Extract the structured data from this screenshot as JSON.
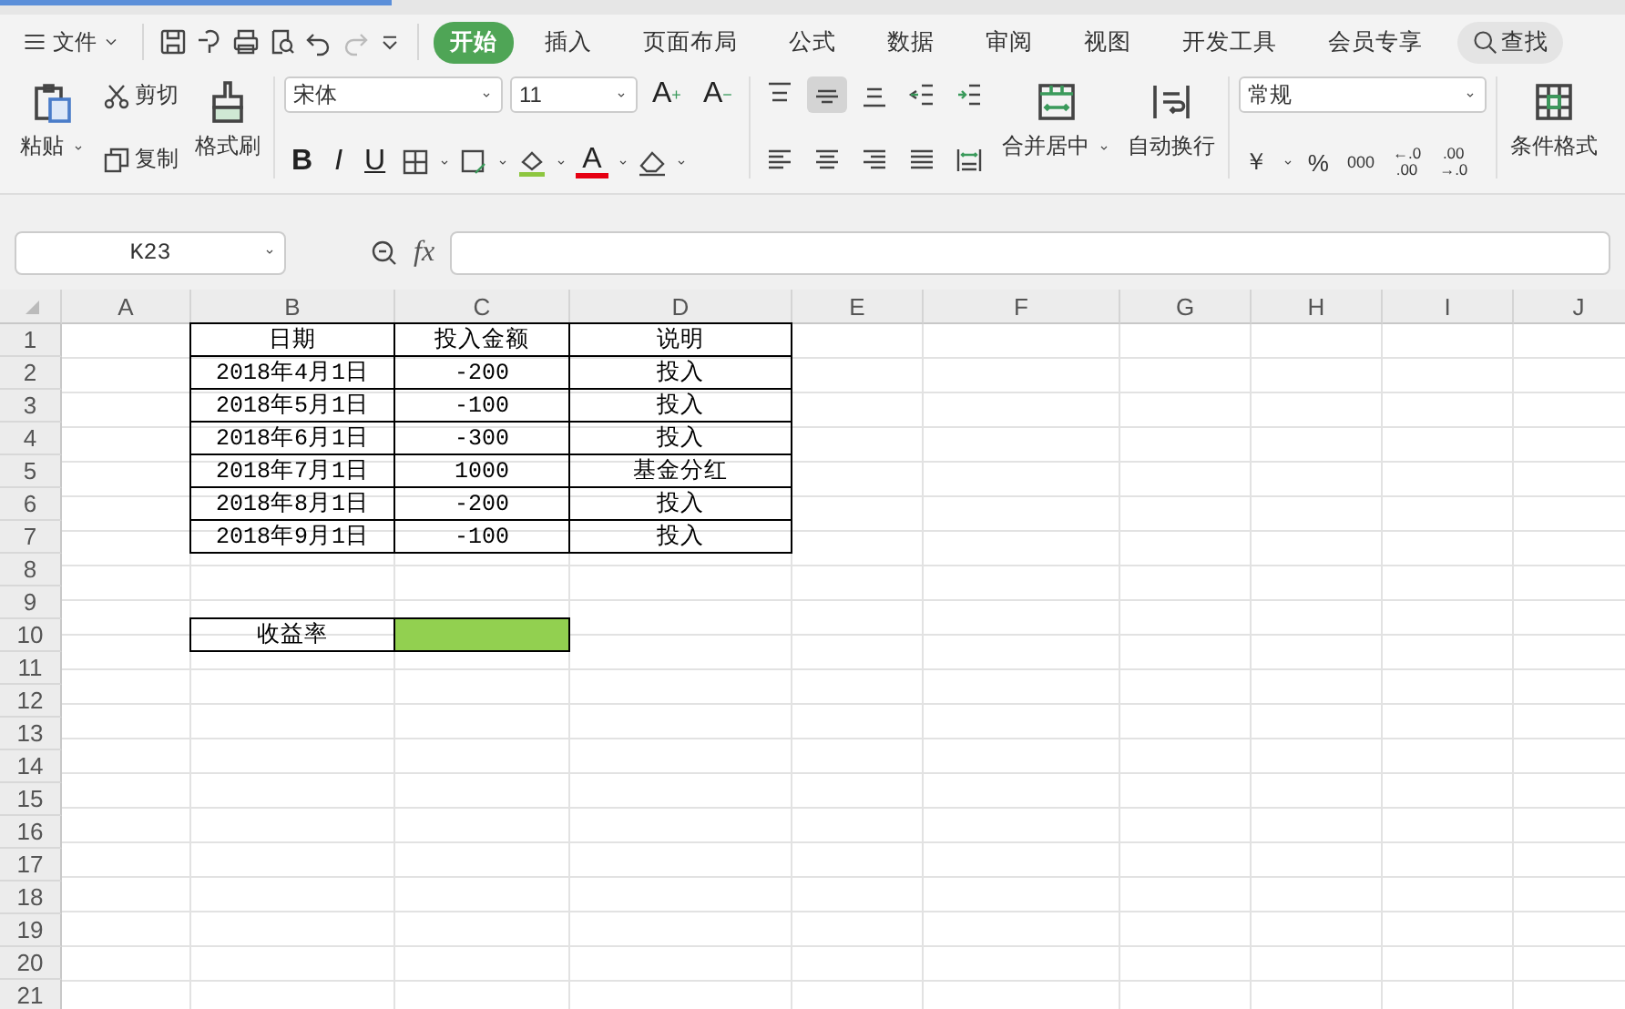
{
  "menu": {
    "file": "文件",
    "tabs": [
      {
        "label": "开始",
        "selected": true
      },
      {
        "label": "插入",
        "selected": false
      },
      {
        "label": "页面布局",
        "selected": false
      },
      {
        "label": "公式",
        "selected": false
      },
      {
        "label": "数据",
        "selected": false
      },
      {
        "label": "审阅",
        "selected": false
      },
      {
        "label": "视图",
        "selected": false
      },
      {
        "label": "开发工具",
        "selected": false
      },
      {
        "label": "会员专享",
        "selected": false
      }
    ],
    "search": "查找"
  },
  "ribbon": {
    "paste": "粘贴",
    "cut": "剪切",
    "copy": "复制",
    "format_painter": "格式刷",
    "font_name": "宋体",
    "font_size": "11",
    "size_buttons": [
      {
        "label": "A",
        "sign": "+"
      },
      {
        "label": "A",
        "sign": "−"
      }
    ],
    "style_buttons": [
      "B",
      "I",
      "U"
    ],
    "font_color": "A",
    "align_top": [
      {
        "kind": "top",
        "selected": false
      },
      {
        "kind": "middle",
        "selected": true
      },
      {
        "kind": "bottom",
        "selected": false
      },
      {
        "kind": "outdent",
        "selected": false
      },
      {
        "kind": "indent",
        "selected": false
      }
    ],
    "align_bottom": [
      {
        "kind": "left",
        "selected": false
      },
      {
        "kind": "center",
        "selected": false
      },
      {
        "kind": "right",
        "selected": false
      },
      {
        "kind": "justify",
        "selected": false
      },
      {
        "kind": "distribute",
        "selected": false
      }
    ],
    "merge": "合并居中",
    "wrap": "自动换行",
    "number_format": "常规",
    "currency": "￥",
    "percent": "%",
    "thousands": "000",
    "decimal_more": [
      "←.0",
      ".00"
    ],
    "decimal_less": [
      ".00",
      "→.0"
    ],
    "conditional": "条件格式"
  },
  "formula_bar": {
    "name_box": "K23",
    "fx": "fx"
  },
  "grid": {
    "columns": [
      "A",
      "B",
      "C",
      "D",
      "E",
      "F",
      "G",
      "H",
      "I",
      "J"
    ],
    "rows": [
      {
        "number": "1",
        "cells": [
          {},
          {
            "text": "日期",
            "bordered": true
          },
          {
            "text": "投入金额",
            "bordered": true
          },
          {
            "text": "说明",
            "bordered": true
          }
        ]
      },
      {
        "number": "2",
        "cells": [
          {},
          {
            "text": "2018年4月1日",
            "bordered": true
          },
          {
            "text": "-200",
            "bordered": true
          },
          {
            "text": "投入",
            "bordered": true
          }
        ]
      },
      {
        "number": "3",
        "cells": [
          {},
          {
            "text": "2018年5月1日",
            "bordered": true
          },
          {
            "text": "-100",
            "bordered": true
          },
          {
            "text": "投入",
            "bordered": true
          }
        ]
      },
      {
        "number": "4",
        "cells": [
          {},
          {
            "text": "2018年6月1日",
            "bordered": true
          },
          {
            "text": "-300",
            "bordered": true
          },
          {
            "text": "投入",
            "bordered": true
          }
        ]
      },
      {
        "number": "5",
        "cells": [
          {},
          {
            "text": "2018年7月1日",
            "bordered": true
          },
          {
            "text": "1000",
            "bordered": true
          },
          {
            "text": "基金分红",
            "bordered": true
          }
        ]
      },
      {
        "number": "6",
        "cells": [
          {},
          {
            "text": "2018年8月1日",
            "bordered": true
          },
          {
            "text": "-200",
            "bordered": true
          },
          {
            "text": "投入",
            "bordered": true
          }
        ]
      },
      {
        "number": "7",
        "cells": [
          {},
          {
            "text": "2018年9月1日",
            "bordered": true
          },
          {
            "text": "-100",
            "bordered": true
          },
          {
            "text": "投入",
            "bordered": true
          }
        ]
      },
      {
        "number": "8",
        "cells": []
      },
      {
        "number": "9",
        "cells": []
      },
      {
        "number": "10",
        "cells": [
          {},
          {
            "text": "收益率",
            "bordered": true
          },
          {
            "bordered": true,
            "color": "#92d050"
          }
        ]
      },
      {
        "number": "11",
        "cells": []
      },
      {
        "number": "12",
        "cells": []
      },
      {
        "number": "13",
        "cells": []
      },
      {
        "number": "14",
        "cells": []
      },
      {
        "number": "15",
        "cells": []
      },
      {
        "number": "16",
        "cells": []
      },
      {
        "number": "17",
        "cells": []
      },
      {
        "number": "18",
        "cells": []
      },
      {
        "number": "19",
        "cells": []
      },
      {
        "number": "20",
        "cells": []
      },
      {
        "number": "21",
        "cells": []
      }
    ]
  }
}
